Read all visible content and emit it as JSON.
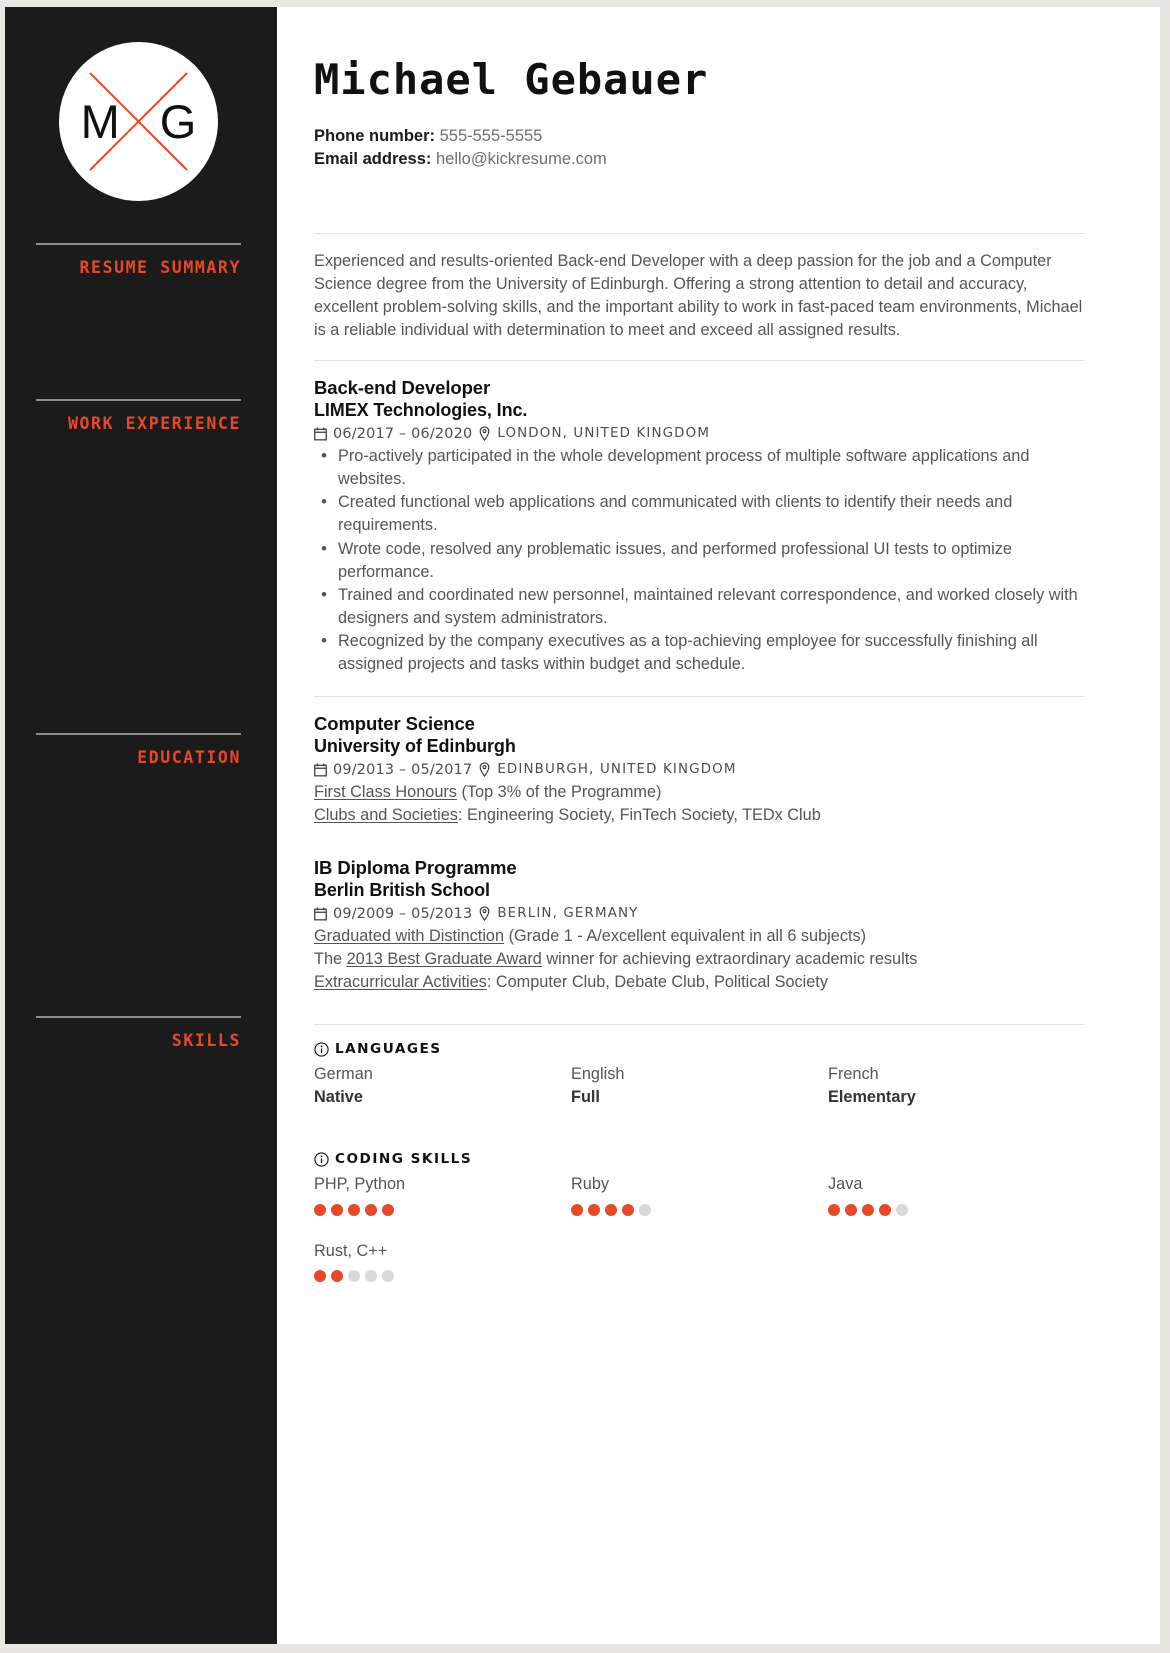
{
  "sidebar": {
    "avatar": {
      "initials": "MG",
      "monogram_left": "M",
      "monogram_right": "G",
      "cross_color": "#e8482a"
    },
    "sections": [
      {
        "label": "RESUME SUMMARY"
      },
      {
        "label": "WORK EXPERIENCE"
      },
      {
        "label": "EDUCATION"
      },
      {
        "label": "SKILLS"
      }
    ]
  },
  "header": {
    "name": "Michael Gebauer",
    "phone_label": "Phone number:",
    "phone_value": "555-555-5555",
    "email_label": "Email address:",
    "email_value": "hello@kickresume.com"
  },
  "summary": {
    "text": "Experienced and results-oriented Back-end Developer with a deep passion for the job and a Computer Science degree from the University of Edinburgh. Offering a strong attention to detail and accuracy, excellent problem-solving skills, and the important ability to work in fast-paced team environments, Michael is a reliable individual with determination to meet and exceed all assigned results."
  },
  "work": {
    "title": "Back-end Developer",
    "org": "LIMEX Technologies, Inc.",
    "dates": "06/2017 – 06/2020",
    "location": "LONDON, UNITED KINGDOM",
    "bullets": [
      "Pro-actively participated in the whole development process of multiple software applications and websites.",
      "Created functional web applications and communicated with clients to identify their needs and requirements.",
      "Wrote code, resolved any problematic issues, and performed professional UI tests to optimize performance.",
      "Trained and coordinated new personnel, maintained relevant correspondence, and worked closely with designers and system administrators.",
      "Recognized by the company executives as a top-achieving employee for successfully finishing all assigned projects and tasks within budget and schedule."
    ]
  },
  "education": [
    {
      "title": "Computer Science",
      "org": "University of Edinburgh",
      "dates": "09/2013 – 05/2017",
      "location": "EDINBURGH, UNITED KINGDOM",
      "details": [
        {
          "underlined": "First Class Honours",
          "rest": " (Top 3% of the Programme)"
        },
        {
          "underlined": "Clubs and Societies",
          "rest": ": Engineering Society, FinTech Society, TEDx Club"
        }
      ]
    },
    {
      "title": "IB Diploma Programme",
      "org": "Berlin British School",
      "dates": "09/2009 – 05/2013",
      "location": "BERLIN, GERMANY",
      "details": [
        {
          "underlined": "Graduated with Distinction",
          "rest": " (Grade 1 - A/excellent equivalent in all 6 subjects)"
        },
        {
          "prefix": "The ",
          "underlined": "2013 Best Graduate Award",
          "rest": " winner for achieving extraordinary academic results"
        },
        {
          "underlined": "Extracurricular Activities",
          "rest": ": Computer Club, Debate Club, Political Society"
        }
      ]
    }
  ],
  "languages": {
    "heading": "LANGUAGES",
    "items": [
      {
        "name": "German",
        "level": "Native"
      },
      {
        "name": "English",
        "level": "Full"
      },
      {
        "name": "French",
        "level": "Elementary"
      }
    ]
  },
  "coding_skills": {
    "heading": "CODING SKILLS",
    "max_dots": 5,
    "items": [
      {
        "name": "PHP, Python",
        "rating": 5
      },
      {
        "name": "Ruby",
        "rating": 4
      },
      {
        "name": "Java",
        "rating": 4
      },
      {
        "name": "Rust, C++",
        "rating": 2
      }
    ]
  },
  "colors": {
    "accent": "#e8482a",
    "sidebar_bg": "#1b1b1b",
    "body_text": "#555555",
    "dot_off": "#d9d9d9"
  }
}
